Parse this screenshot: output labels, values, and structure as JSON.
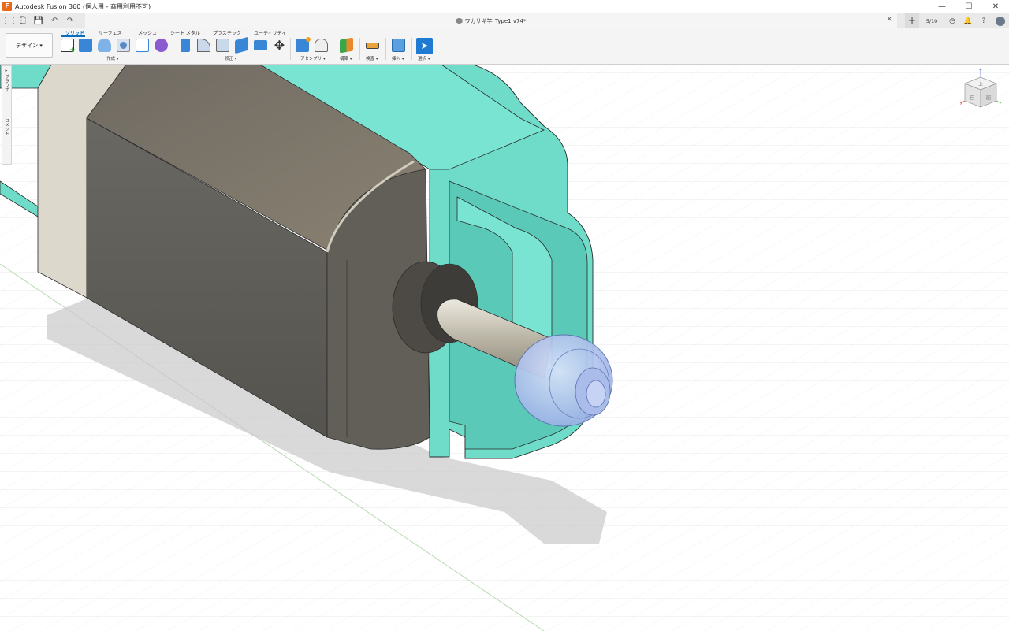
{
  "window": {
    "title": "Autodesk Fusion 360 (個人用 - 商用利用不可)",
    "logo_letter": "F",
    "minimize": "—",
    "maximize": "☐",
    "close": "✕"
  },
  "docbar": {
    "document_title": "ワカサギ竿_Type1 v74*",
    "tab_close": "✕",
    "add_tab": "+",
    "job_count": "5/10",
    "grid_icon": "⋮⋮⋮",
    "file_icon": "🗋",
    "save_icon": "💾",
    "undo_icon": "↶",
    "redo_icon": "↷",
    "clock_icon": "◷",
    "bell_icon": "🔔",
    "help_icon": "?"
  },
  "toolbar": {
    "workspace_label": "デザイン ▾",
    "tabs": [
      {
        "label": "ソリッド",
        "active": true
      },
      {
        "label": "サーフェス",
        "active": false
      },
      {
        "label": "メッシュ",
        "active": false
      },
      {
        "label": "シート メタル",
        "active": false
      },
      {
        "label": "プラスチック",
        "active": false
      },
      {
        "label": "ユーティリティ",
        "active": false
      }
    ],
    "groups": {
      "create": "作成 ▾",
      "modify": "修正 ▾",
      "assemble": "アセンブリ ▾",
      "construct": "構築 ▾",
      "inspect": "検査 ▾",
      "insert": "挿入 ▾",
      "select": "選択 ▾"
    }
  },
  "browser_panel": {
    "tab_browser": "▸ ブラウザ",
    "tab_comments": "コメント"
  },
  "viewcube": {
    "top_label": "上",
    "front_label": "右",
    "right_label": "前",
    "axis_z": "Z",
    "axis_x": "X",
    "axis_y": "Y"
  },
  "colors": {
    "teal_body": "#6fdcc9",
    "teal_dark": "#4fbfad",
    "motor_dark": "#5c5a55",
    "motor_top": "#807a6c",
    "collar": "#dcd8cc",
    "shaft": "#c9c4b4",
    "wheel": "#b8c8ee",
    "accent": "#0a6ebd"
  }
}
